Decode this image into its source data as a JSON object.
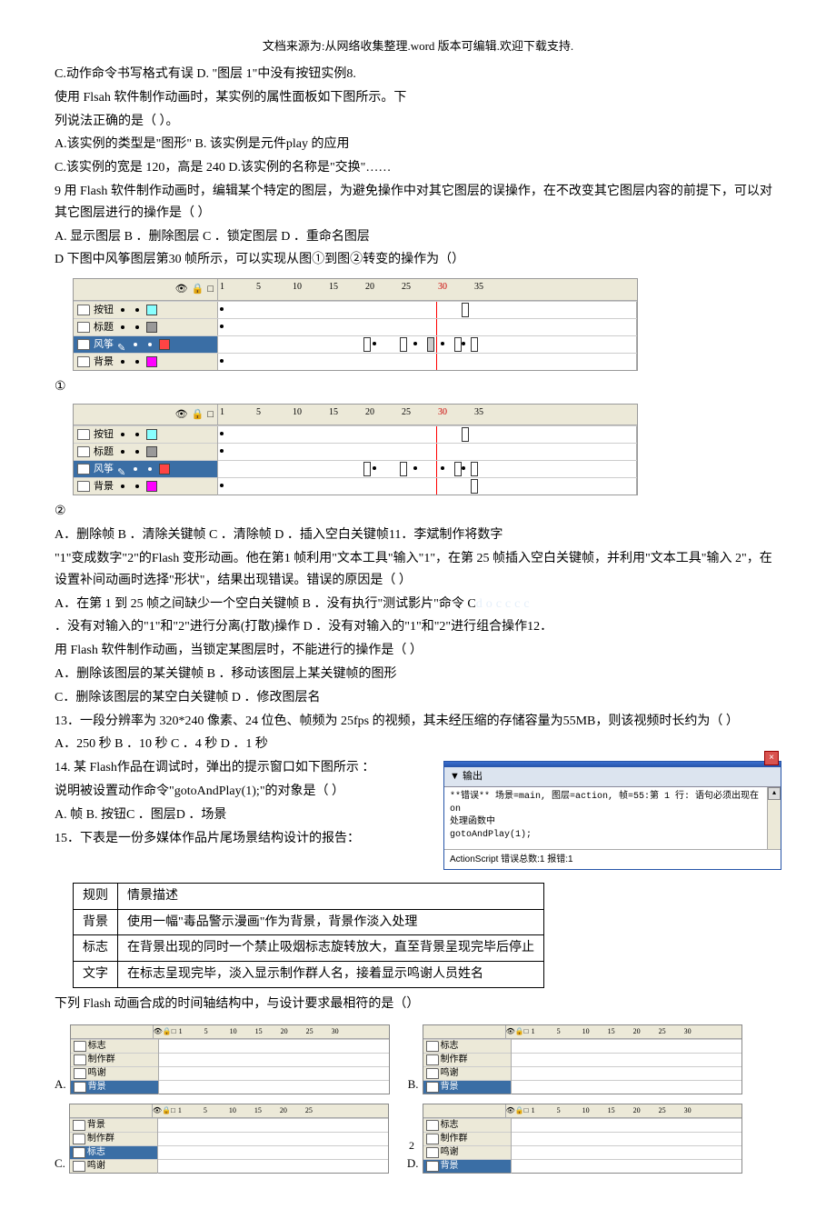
{
  "header_note": "文档来源为:从网络收集整理.word 版本可编辑.欢迎下载支持.",
  "q7_stem1": "C.动作命令书写格式有误  D.   \"图层  1\"中没有按钮实例8.",
  "q7_stem2": "使用 Flsah 软件制作动画时，某实例的属性面板如下图所示。下",
  "q7_stem3": "列说法正确的是（ ）。",
  "q7_a": " A.该实例的类型是\"图形\"  B.     该实例是元件play 的应用",
  "q7_c": "C.该实例的宽是 120，高是 240 D.该实例的名称是\"交换\"……",
  "q9_stem": "9  用 Flash 软件制作动画时，编辑某个特定的图层，为避免操作中对其它图层的误操作，在不改变其它图层内容的前提下，可以对其它图层进行的操作是（   ）",
  "q9_opts": " A.  显示图层  B ．删除图层   C  ．锁定图层  D     ．重命名图层",
  "q10_stem": "D  下图中风筝图层第30 帧所示，可以实现从图①到图②转变的操作为（）",
  "tl_numbers": [
    "1",
    "5",
    "10",
    "15",
    "20",
    "25",
    "30",
    "35"
  ],
  "layers": {
    "l1": "按钮",
    "l2": "标题",
    "l3": "风筝",
    "l4": "背景"
  },
  "circled1": "①",
  "circled2": "②",
  "q11_line1": "A．删除帧  B    ．清除关键帧  C    ．清除帧  D    ．插入空白关键帧11．李斌制作将数字",
  "q11_line2": "\"1\"变成数字\"2\"的Flash 变形动画。他在第1 帧利用\"文本工具\"输入\"1\"，在第 25 帧插入空白关键帧，并利用\"文本工具\"输入 2\"，在设置补间动画时选择\"形状\"，结果出现错误。错误的原因是（ ）",
  "q11_a": " A．在第 1 到 25 帧之间缺少一个空白关键帧  B    ．没有执行\"测试影片\"命令       C",
  "q11_c": "．没有对输入的\"1\"和\"2\"进行分离(打散)操作  D  ．没有对输入的\"1\"和\"2\"进行组合操作12．",
  "q12_stem": "用 Flash 软件制作动画，当锁定某图层时，不能进行的操作是（     ）",
  "q12_a": " A．删除该图层的某关键帧  B    ．移动该图层上某关键帧的图形",
  "q12_c": " C．删除该图层的某空白关键帧 D ．修改图层名",
  "q13_stem": "13．一段分辨率为 320*240 像素、24 位色、帧频为 25fps 的视频，其未经压缩的存储容量为55MB，则该视频时长约为（ ）",
  "q13_opts": " A．250 秒   B  ．10 秒    C    ．4 秒   D     ．1 秒",
  "q14_l1": "14. 某 Flash作品在调试时，弹出的提示窗口如下图所示 ：",
  "q14_l2": "说明被设置动作命令\"gotoAndPlay(1);\"的对象是（ ）",
  "q14_l3": "A. 帧   B. 按钮C ．图层D ．场景",
  "q15_stem": "15．下表是一份多媒体作品片尾场景结构设计的报告：",
  "err_tab": "▼ 输出",
  "err_body1": "**错误** 场景=main, 图层=action, 帧=55:第 1 行: 语句必须出现在 on",
  "err_body2": "处理函数中",
  "err_body3": "      gotoAndPlay(1);",
  "err_footer": "ActionScript 错误总数:1   报错:1",
  "table": {
    "h1": "规则",
    "h2": "情景描述",
    "r1a": "背景",
    "r1b": "使用一幅\"毒品警示漫画\"作为背景，背景作淡入处理",
    "r2a": "标志",
    "r2b": "在背景出现的同时一个禁止吸烟标志旋转放大，直至背景呈现完毕后停止",
    "r3a": "文字",
    "r3b": "在标志呈现完毕，淡入显示制作群人名，接着显示鸣谢人员姓名"
  },
  "q15_after": "下列 Flash 动画合成的时间轴结构中，与设计要求最相符的是（）",
  "mini_numbers": [
    "1",
    "5",
    "10",
    "15",
    "20",
    "25",
    "30"
  ],
  "mini_layers_a": [
    "标志",
    "制作群",
    "鸣谢",
    "背景"
  ],
  "mini_layers_b": [
    "标志",
    "制作群",
    "鸣谢",
    "背景"
  ],
  "mini_layers_c": [
    "背景",
    "制作群",
    "标志",
    "鸣谢"
  ],
  "mini_layers_d": [
    "标志",
    "制作群",
    "鸣谢",
    "背景"
  ],
  "opt_a": "A.",
  "opt_b": "B.",
  "opt_c": "C.",
  "opt_d": "D.",
  "watermark": "docccc",
  "page_num": "2"
}
